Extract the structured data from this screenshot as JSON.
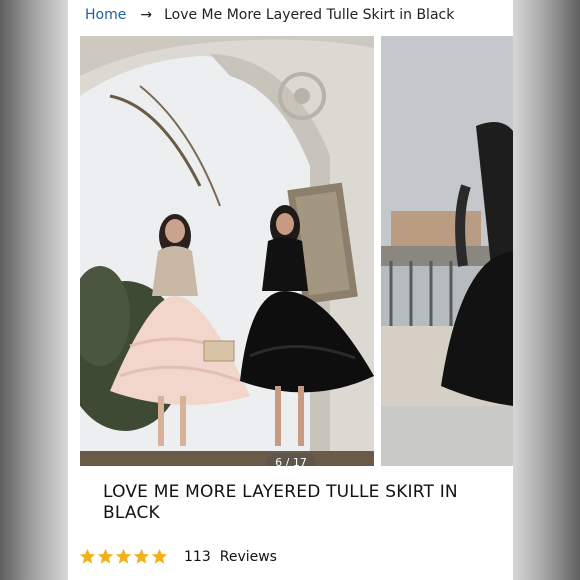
{
  "breadcrumb": {
    "home": "Home",
    "separator": "→",
    "current": "Love Me More Layered Tulle Skirt in Black"
  },
  "gallery": {
    "counter": "6 / 17"
  },
  "product": {
    "title": "LOVE ME MORE LAYERED TULLE SKIRT IN BLACK",
    "rating_stars": 5,
    "review_count": "113",
    "review_label": "Reviews"
  },
  "colors": {
    "link": "#1f5fa0",
    "star": "#f2b01e",
    "text": "#111111"
  },
  "icons": [
    "arrow-right-icon",
    "star-icon"
  ]
}
